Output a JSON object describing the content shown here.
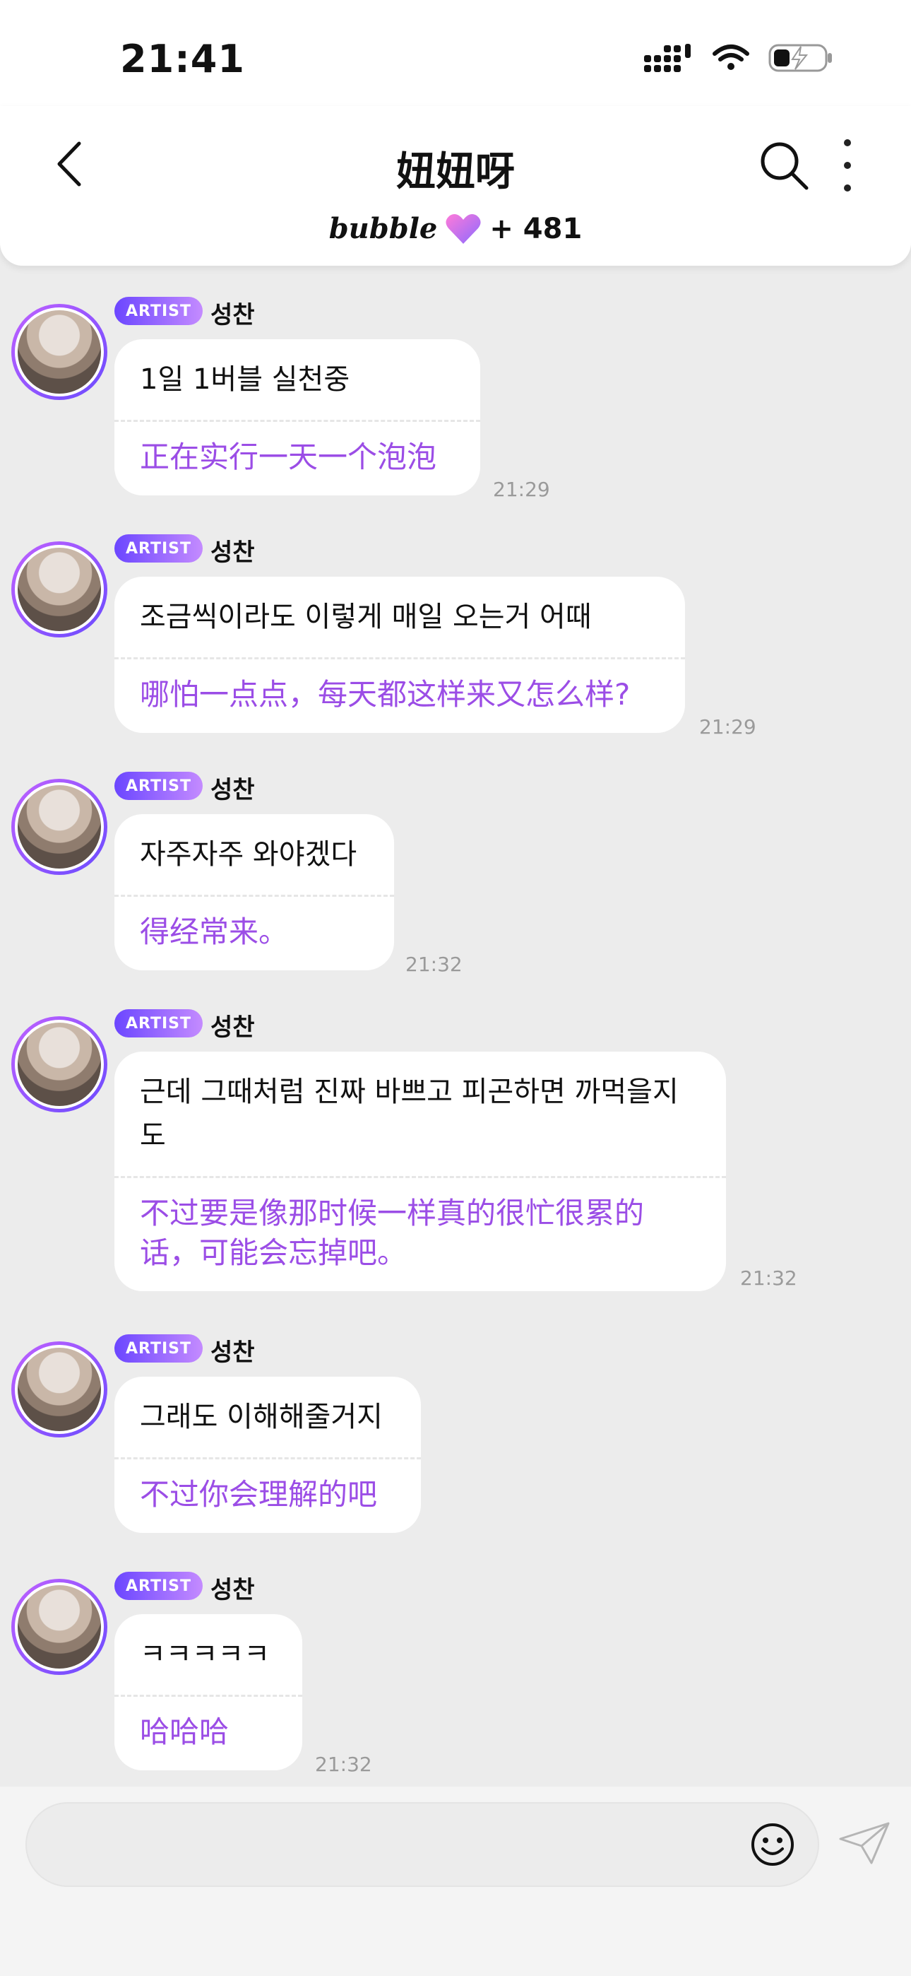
{
  "status": {
    "time": "21:41"
  },
  "header": {
    "title": "妞妞呀",
    "bubble_logo": "bubble",
    "bubble_count": "+ 481"
  },
  "messages": [
    {
      "badge": "ARTIST",
      "sender": "성찬",
      "original": "1일 1버블 실천중",
      "translation": "正在实行一天一个泡泡",
      "time": "21:29"
    },
    {
      "badge": "ARTIST",
      "sender": "성찬",
      "original": "조금씩이라도 이렇게 매일 오는거 어때",
      "translation": "哪怕一点点，每天都这样来又怎么样?",
      "time": "21:29"
    },
    {
      "badge": "ARTIST",
      "sender": "성찬",
      "original": "자주자주 와야겠다",
      "translation": "得经常来。",
      "time": "21:32"
    },
    {
      "badge": "ARTIST",
      "sender": "성찬",
      "original": "근데 그때처럼 진짜 바쁘고 피곤하면 까먹을지도",
      "translation": "不过要是像那时候一样真的很忙很累的话，可能会忘掉吧。",
      "time": "21:32"
    },
    {
      "badge": "ARTIST",
      "sender": "성찬",
      "original": "그래도 이해해줄거지",
      "translation": "不过你会理解的吧",
      "time": ""
    },
    {
      "badge": "ARTIST",
      "sender": "성찬",
      "original": "ㅋㅋㅋㅋㅋ",
      "translation": "哈哈哈",
      "time": "21:32"
    }
  ],
  "icons": {
    "back": "chevron-left-icon",
    "search": "search-icon",
    "more": "more-vertical-icon",
    "heart": "heart-icon",
    "emoji": "emoji-icon",
    "send": "send-icon"
  },
  "colors": {
    "accent": "#9b4de6",
    "badge_start": "#6b46ff",
    "badge_end": "#c48bff"
  }
}
